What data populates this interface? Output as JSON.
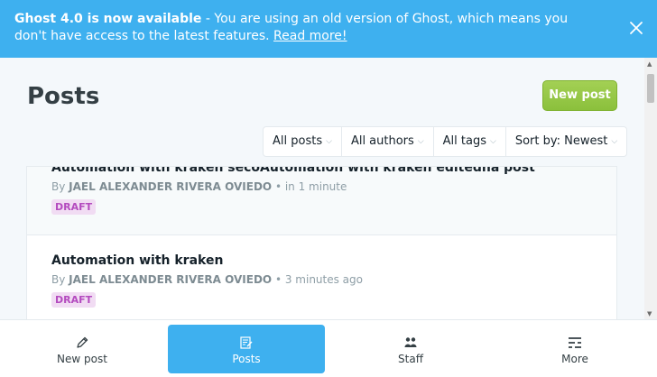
{
  "banner": {
    "headline": "Ghost 4.0 is now available",
    "separator": " - ",
    "message": "You are using an old version of Ghost, which means you don't have access to the latest features.",
    "link": "Read more!"
  },
  "header": {
    "title": "Posts",
    "new_post_button": "New post"
  },
  "filters": [
    {
      "label": "All posts"
    },
    {
      "label": "All authors"
    },
    {
      "label": "All tags"
    },
    {
      "label": "Sort by: Newest"
    }
  ],
  "posts": [
    {
      "title": "Automation with kraken secoAutomation with kraken editedna post",
      "by": "By",
      "author": "JAEL ALEXANDER RIVERA OVIEDO",
      "time": "• in 1 minute",
      "status": "DRAFT"
    },
    {
      "title": "Automation with kraken",
      "by": "By",
      "author": "JAEL ALEXANDER RIVERA OVIEDO",
      "time": "• 3 minutes ago",
      "status": "DRAFT"
    }
  ],
  "bottom_nav": [
    {
      "label": "New post",
      "icon": "pencil-icon",
      "active": false
    },
    {
      "label": "Posts",
      "icon": "posts-icon",
      "active": true
    },
    {
      "label": "Staff",
      "icon": "staff-icon",
      "active": false
    },
    {
      "label": "More",
      "icon": "more-icon",
      "active": false
    }
  ],
  "colors": {
    "accent": "#3eb0ef",
    "primary_button": "#9fcc4e",
    "draft_badge_bg": "#f1dcf3",
    "draft_badge_text": "#b44bbf"
  }
}
